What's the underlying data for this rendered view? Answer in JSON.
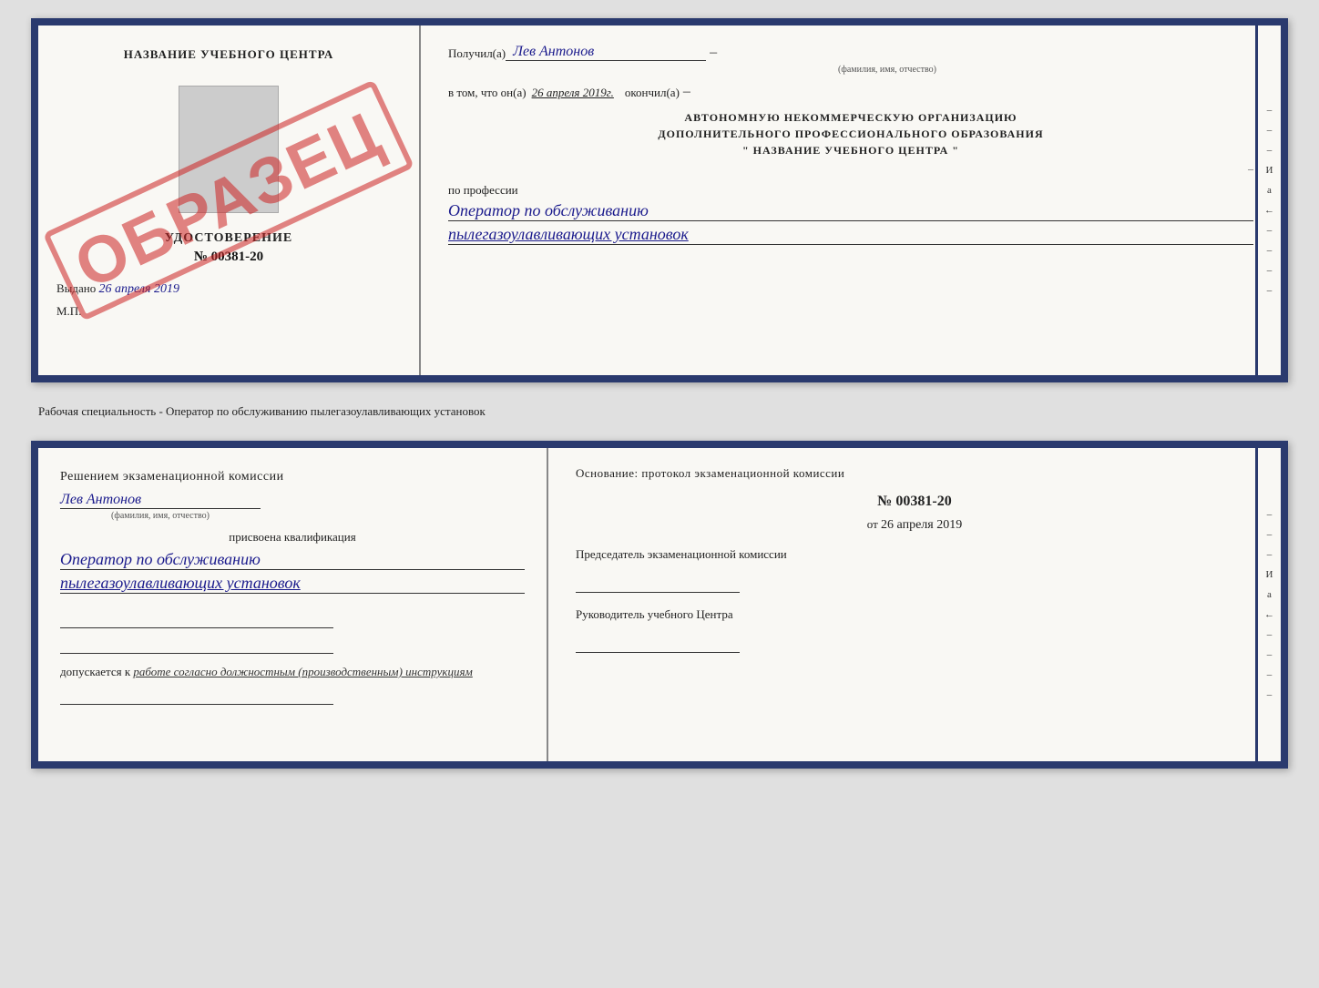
{
  "top_doc": {
    "left": {
      "center_title": "НАЗВАНИЕ УЧЕБНОГО ЦЕНТРА",
      "udostoverenie_label": "УДОСТОВЕРЕНИЕ",
      "doc_number": "№ 00381-20",
      "vydano_text": "Выдано",
      "vydano_date": "26 апреля 2019",
      "mp_label": "М.П.",
      "stamp_text": "ОБРАЗЕЦ"
    },
    "right": {
      "poluchil_label": "Получил(а)",
      "poluchil_value": "Лев Антонов",
      "fio_hint": "(фамилия, имя, отчество)",
      "vtom_label": "в том, что он(а)",
      "vtom_date": "26 апреля 2019г.",
      "okonchill_label": "окончил(а)",
      "org_line1": "АВТОНОМНУЮ НЕКОММЕРЧЕСКУЮ ОРГАНИЗАЦИЮ",
      "org_line2": "ДОПОЛНИТЕЛЬНОГО ПРОФЕССИОНАЛЬНОГО ОБРАЗОВАНИЯ",
      "org_line3": "\" НАЗВАНИЕ УЧЕБНОГО ЦЕНТРА \"",
      "po_professii": "по профессии",
      "profession_line1": "Оператор по обслуживанию",
      "profession_line2": "пылегазоулавливающих установок"
    }
  },
  "middle": {
    "text": "Рабочая специальность - Оператор по обслуживанию пылегазоулавливающих установок"
  },
  "bottom_doc": {
    "left": {
      "resheniem_label": "Решением экзаменационной комиссии",
      "name_value": "Лев Антонов",
      "fio_hint": "(фамилия, имя, отчество)",
      "prisvoena_label": "присвоена квалификация",
      "qualification_line1": "Оператор по обслуживанию",
      "qualification_line2": "пылегазоулавливающих установок",
      "dopuskaetsya_label": "допускается к",
      "dopuskaetsya_value": "работе согласно должностным (производственным) инструкциям"
    },
    "right": {
      "osnovanie_label": "Основание: протокол экзаменационной комиссии",
      "number_label": "№ 00381-20",
      "ot_label": "от",
      "ot_date": "26 апреля 2019",
      "predsedatel_label": "Председатель экзаменационной комиссии",
      "rukovoditel_label": "Руководитель учебного Центра"
    },
    "right_border": {
      "letters": [
        "И",
        "а",
        "←",
        "–",
        "–",
        "–",
        "–",
        "–"
      ]
    }
  }
}
